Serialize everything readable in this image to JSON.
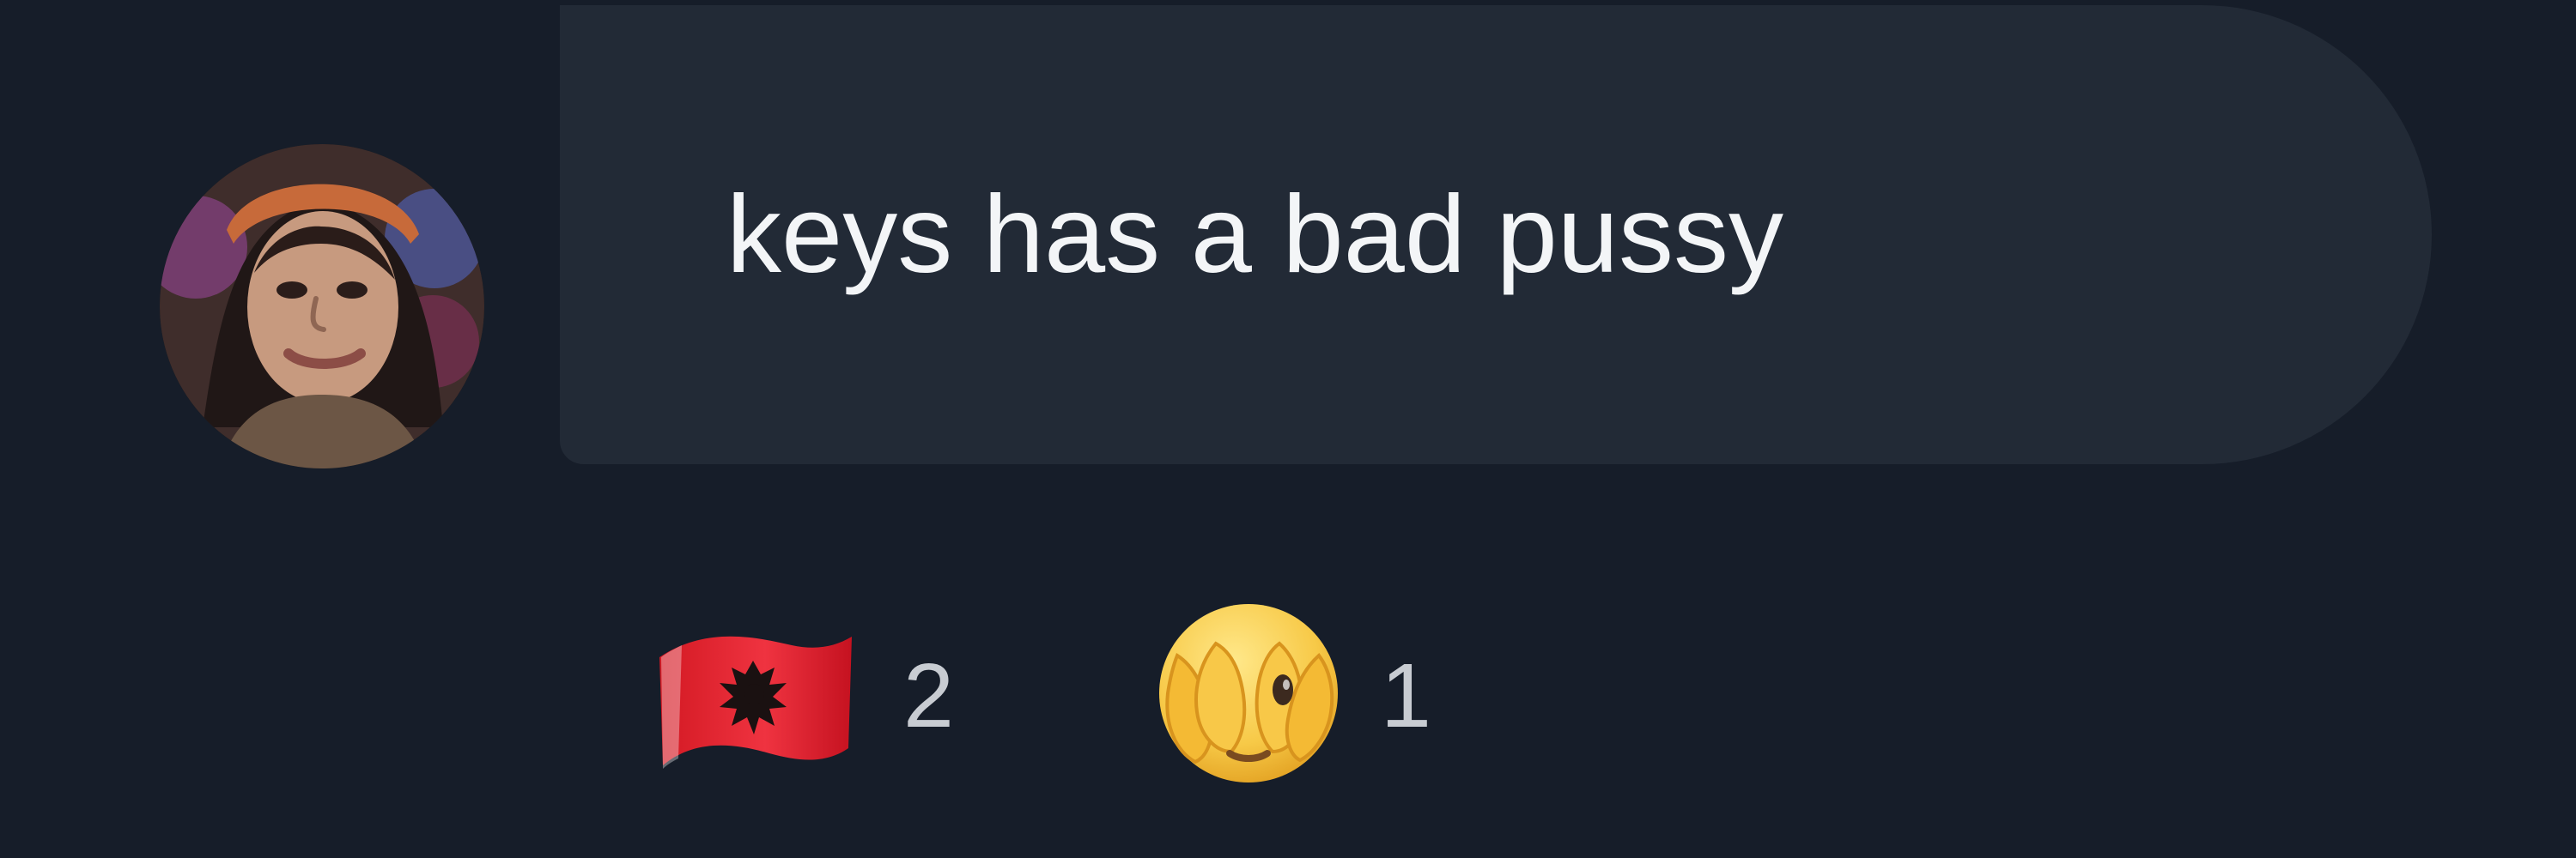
{
  "comment": {
    "author_avatar": "user-avatar",
    "text": "keys has a bad pussy"
  },
  "reactions": [
    {
      "icon": "albania-flag-icon",
      "count": "2"
    },
    {
      "icon": "face-covering-eyes-icon",
      "count": "1"
    }
  ],
  "colors": {
    "background": "#161d29",
    "bubble": "#222a36",
    "text": "#f3f5f7",
    "count_text": "#c8ccd2"
  }
}
